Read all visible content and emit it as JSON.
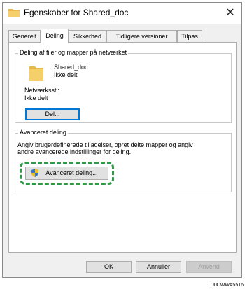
{
  "window": {
    "title": "Egenskaber for Shared_doc",
    "close_glyph": "✕"
  },
  "tabs": [
    {
      "label": "Generelt",
      "active": false
    },
    {
      "label": "Deling",
      "active": true
    },
    {
      "label": "Sikkerhed",
      "active": false
    },
    {
      "label": "Tidligere versioner",
      "active": false
    },
    {
      "label": "Tilpas",
      "active": false
    }
  ],
  "network_sharing": {
    "group_title": "Deling af filer og mapper på netværket",
    "folder_name": "Shared_doc",
    "folder_status": "Ikke delt",
    "path_label": "Netværkssti:",
    "path_value": "Ikke delt",
    "share_button": "Del..."
  },
  "advanced_sharing": {
    "group_title": "Avanceret deling",
    "description_line1": "Angiv brugerdefinerede tilladelser, opret delte mapper og angiv",
    "description_line2": "andre avancerede indstillinger for deling.",
    "button_label": "Avanceret deling...",
    "button_icon": "uac-shield-icon"
  },
  "footer": {
    "ok_label": "OK",
    "cancel_label": "Annuller",
    "apply_label": "Anvend"
  },
  "caption": "D0CWWA5516",
  "colors": {
    "highlight": "#2e9a47",
    "folder": "#e8b84a",
    "focus": "#0078d7"
  }
}
